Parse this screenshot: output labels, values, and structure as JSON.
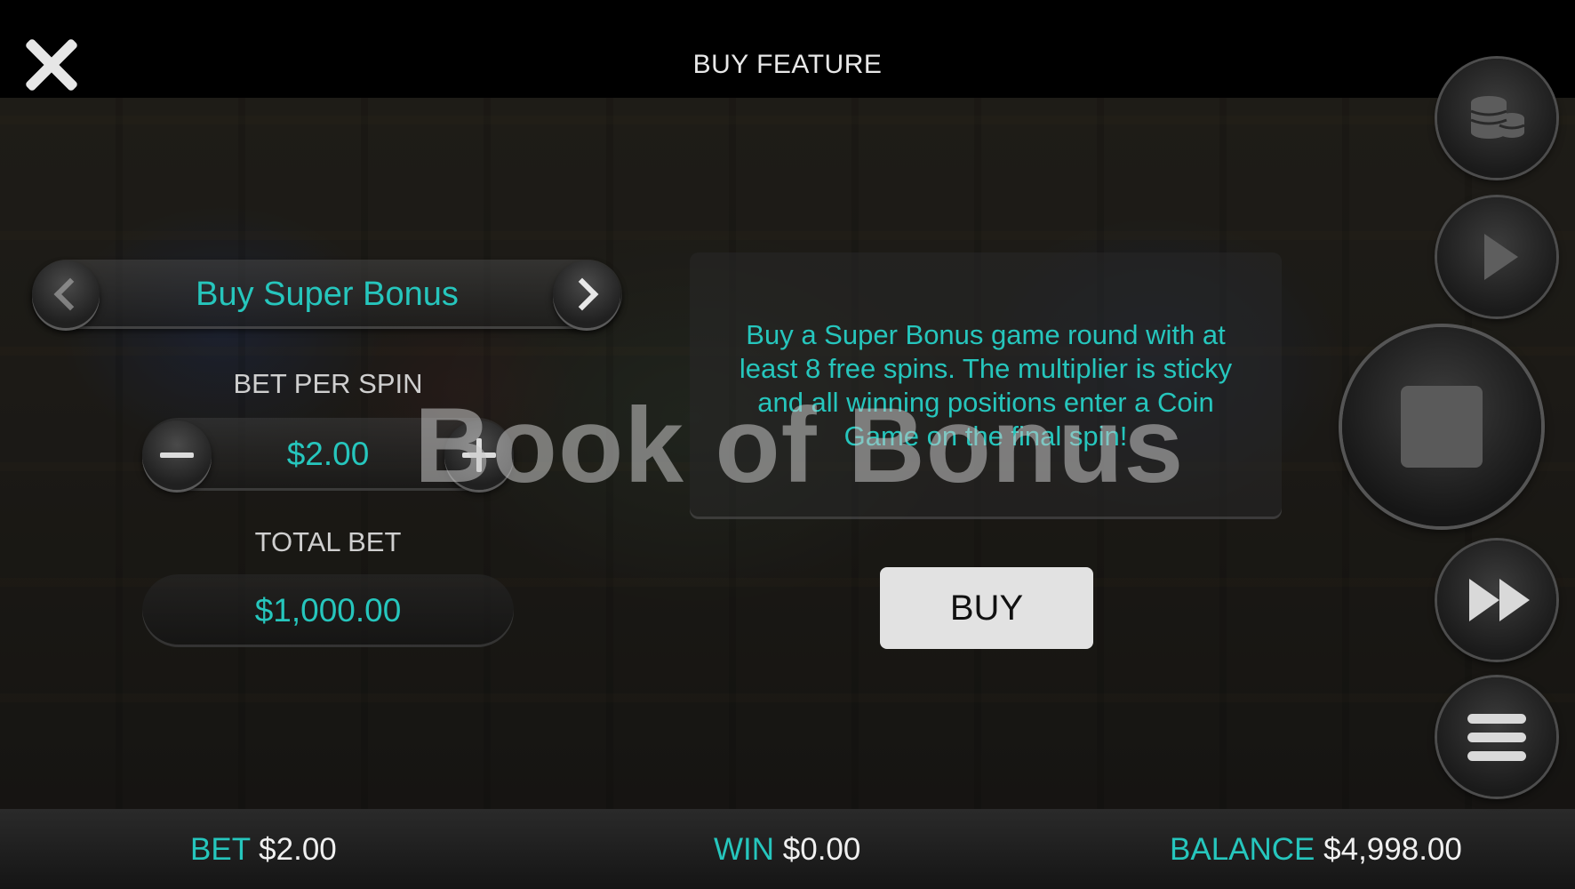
{
  "header": {
    "title": "BUY FEATURE",
    "close_icon": "close-icon"
  },
  "feature": {
    "name": "Buy Super Bonus",
    "prev_icon": "chevron-left-icon",
    "next_icon": "chevron-right-icon",
    "description": "Buy a Super Bonus game round with at least 8 free spins. The multiplier is sticky and all winning positions enter a Coin Game on the final spin!",
    "buy_label": "BUY"
  },
  "bet": {
    "per_spin_label": "BET PER SPIN",
    "per_spin_value": "$2.00",
    "total_label": "TOTAL BET",
    "total_value": "$1,000.00",
    "minus_icon": "minus-icon",
    "plus_icon": "plus-icon"
  },
  "watermark": "Book of Bonus",
  "side_controls": {
    "coins_icon": "coins-icon",
    "autoplay_icon": "play-icon",
    "stop_icon": "stop-icon",
    "turbo_icon": "fast-forward-icon",
    "menu_icon": "menu-icon"
  },
  "footer": {
    "bet_label": "BET",
    "bet_value": "$2.00",
    "win_label": "WIN",
    "win_value": "$0.00",
    "balance_label": "BALANCE",
    "balance_value": "$4,998.00"
  },
  "colors": {
    "accent": "#26c6bd",
    "buy_button": "#e2e2e2"
  }
}
